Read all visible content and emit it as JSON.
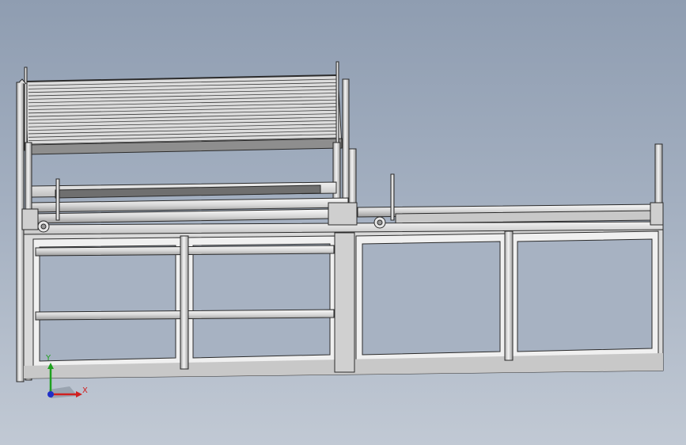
{
  "viewport": {
    "colors": {
      "background_top": "#8f9db1",
      "background_bottom": "#c1c9d4",
      "part_fill": "#e8e8e8",
      "part_edge": "#2b2b2b",
      "shade": "#9e9e9e"
    }
  },
  "triad": {
    "x_label": "X",
    "y_label": "Y",
    "x_color": "#d02020",
    "y_color": "#1ea01e",
    "z_color": "#2030c8"
  }
}
